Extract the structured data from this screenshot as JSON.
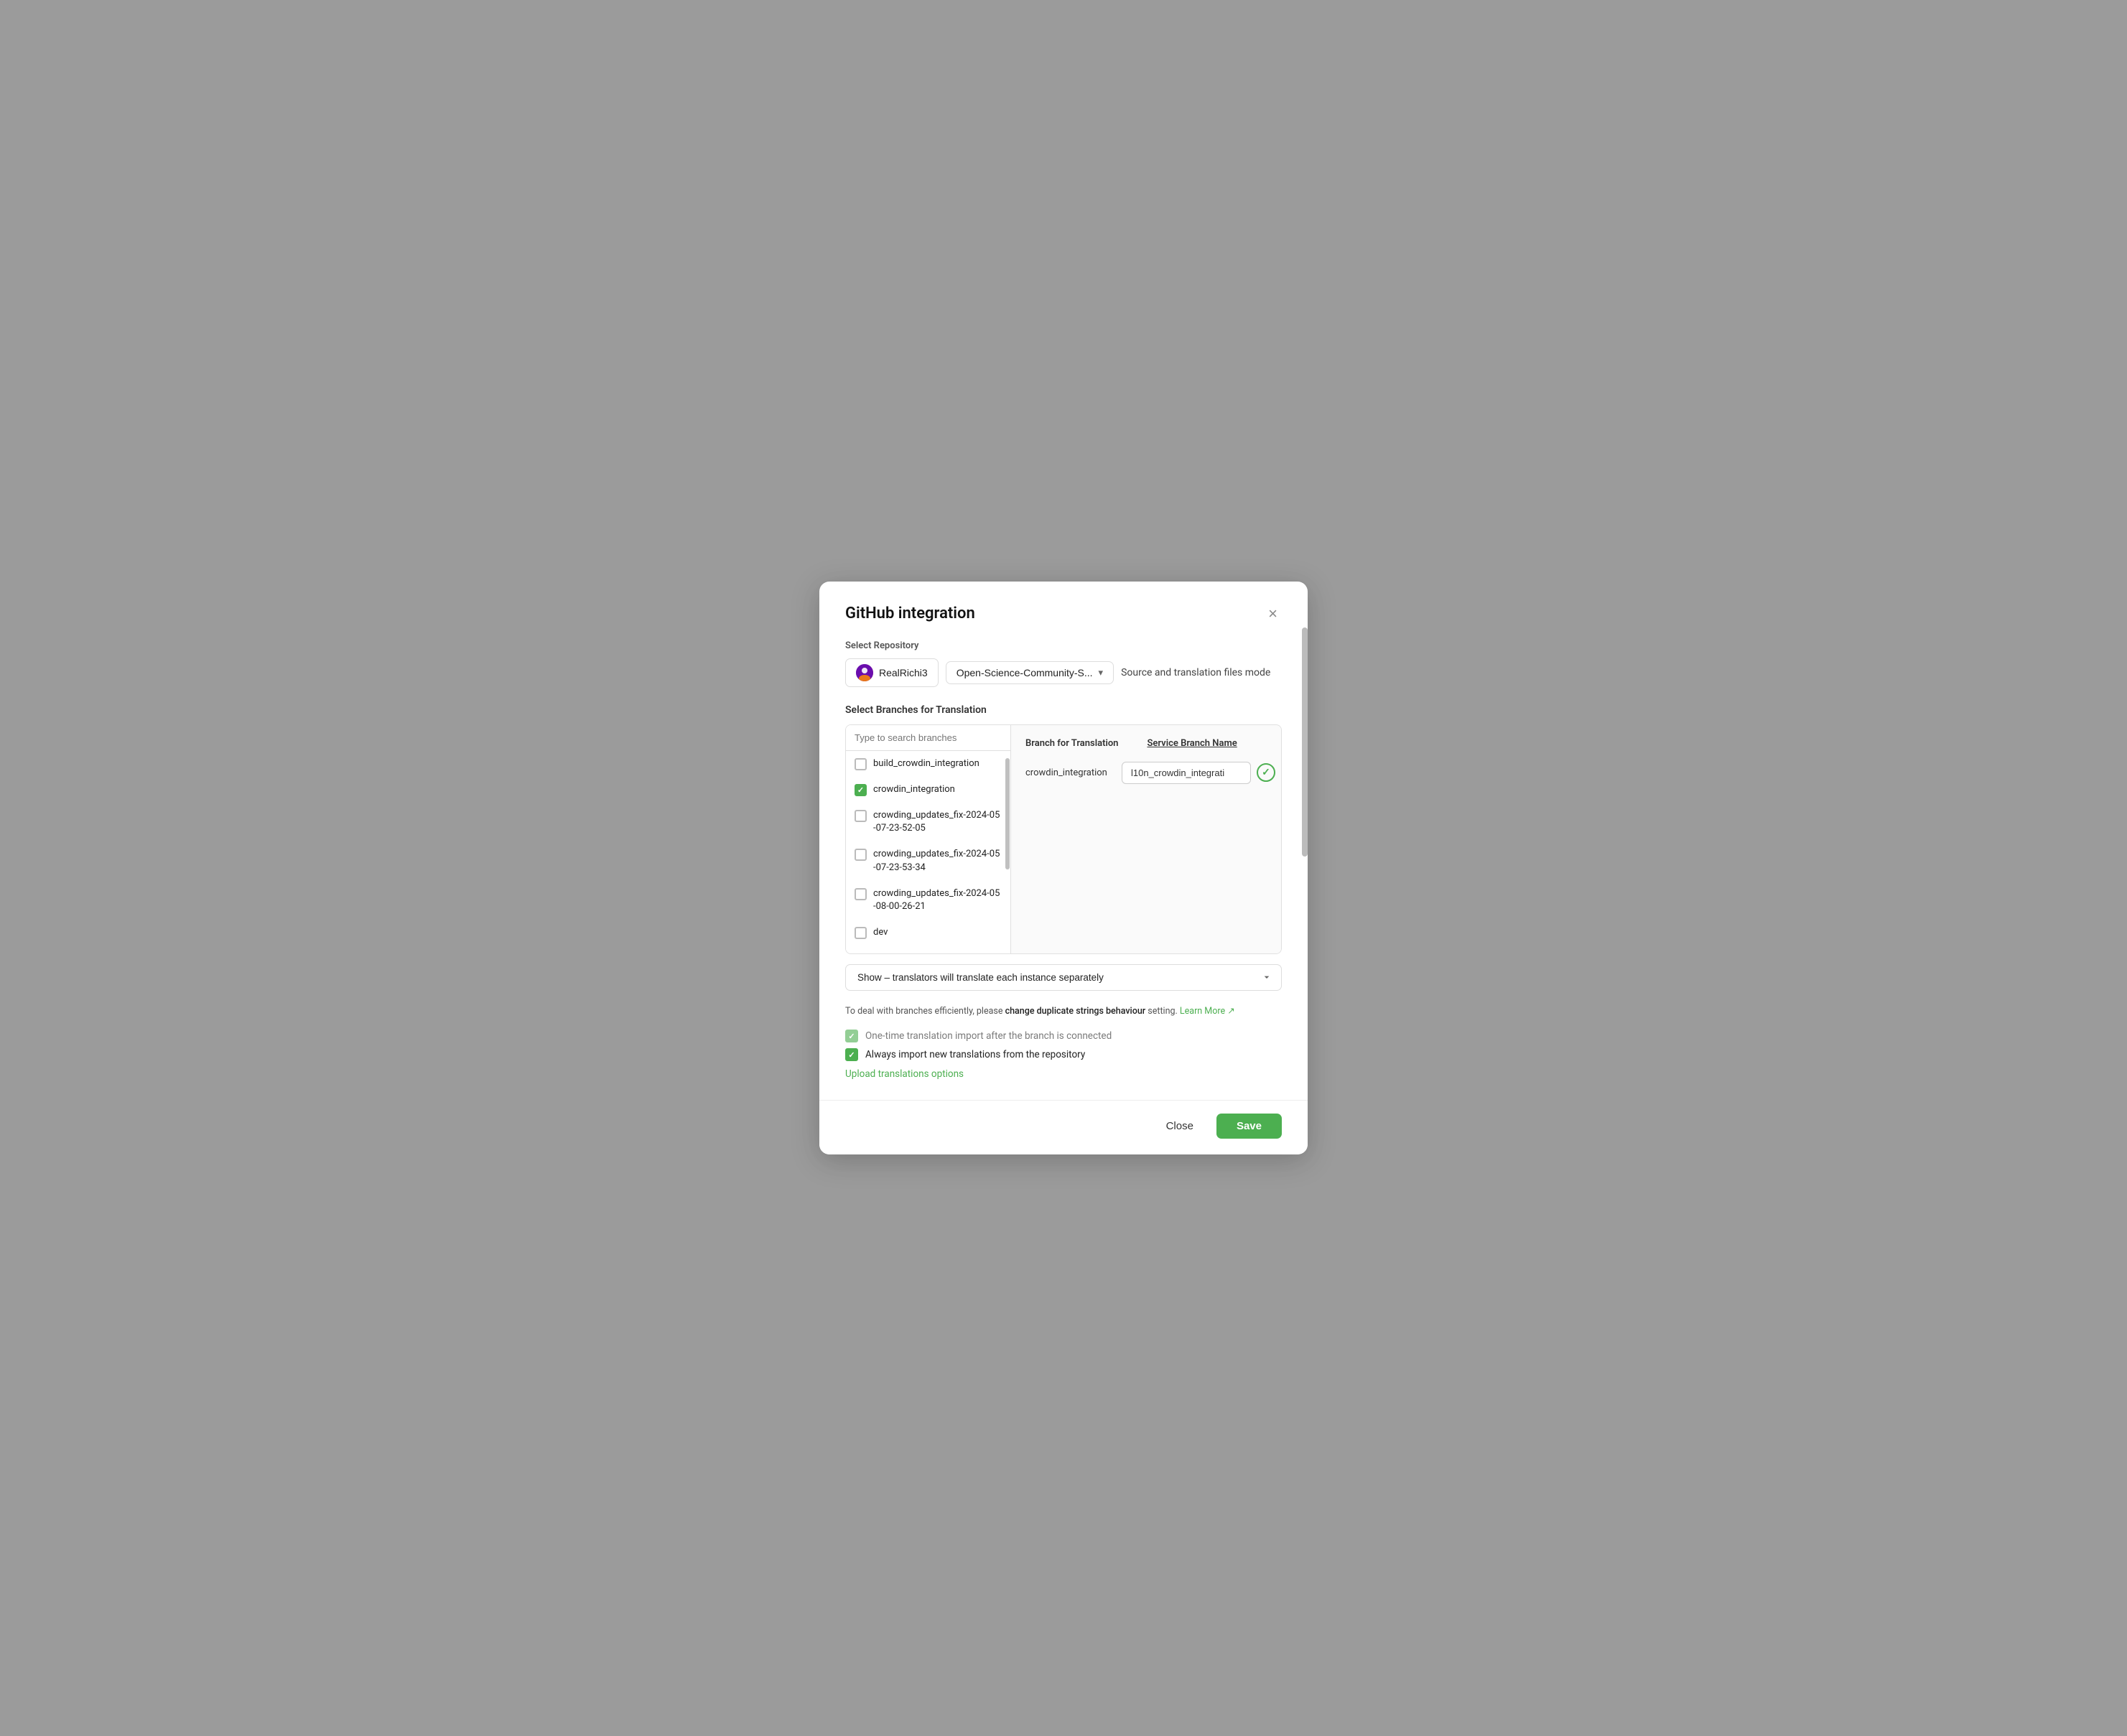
{
  "modal": {
    "title": "GitHub integration",
    "close_label": "×"
  },
  "repository": {
    "section_label": "Select Repository",
    "user": "RealRichi3",
    "repo_name": "Open-Science-Community-S...",
    "mode": "Source and translation files mode"
  },
  "branches": {
    "section_label": "Select Branches for Translation",
    "search_placeholder": "Type to search branches",
    "items": [
      {
        "name": "build_crowdin_integration",
        "checked": false,
        "disabled": false
      },
      {
        "name": "crowdin_integration",
        "checked": true,
        "disabled": false
      },
      {
        "name": "crowding_updates_fix-2024-05-07-23-52-05",
        "checked": false,
        "disabled": false
      },
      {
        "name": "crowding_updates_fix-2024-05-07-23-53-34",
        "checked": false,
        "disabled": false
      },
      {
        "name": "crowding_updates_fix-2024-05-08-00-26-21",
        "checked": false,
        "disabled": false
      },
      {
        "name": "dev",
        "checked": false,
        "disabled": false
      }
    ]
  },
  "translation_table": {
    "col1_header": "Branch for Translation",
    "col2_header": "Service Branch Name",
    "rows": [
      {
        "branch": "crowdin_integration",
        "service_branch": "l10n_crowdin_integrati"
      }
    ]
  },
  "duplicate_strings": {
    "label": "Show – translators will translate each instance separately"
  },
  "hint": {
    "text_before": "To deal with branches efficiently, please ",
    "link_text": "change duplicate strings behaviour",
    "text_after": " setting.",
    "learn_more": "Learn More"
  },
  "checkboxes": {
    "one_time_import": {
      "label": "One-time translation import after the branch is connected",
      "checked": true,
      "disabled": true
    },
    "always_import": {
      "label": "Always import new translations from the repository",
      "checked": true,
      "disabled": false
    }
  },
  "upload_link": "Upload translations options",
  "footer": {
    "close_label": "Close",
    "save_label": "Save"
  }
}
